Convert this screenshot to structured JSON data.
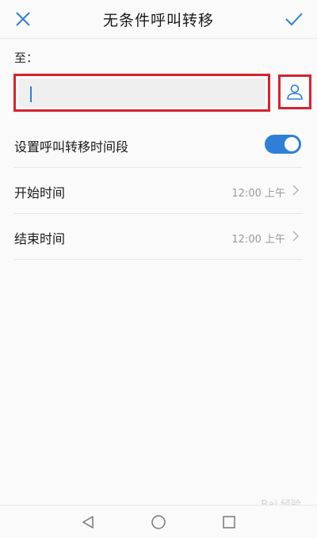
{
  "header": {
    "title": "无条件呼叫转移",
    "close_icon": "close-icon",
    "confirm_icon": "check-icon"
  },
  "forward_to": {
    "label": "至：",
    "value": "",
    "contact_icon": "person-icon"
  },
  "settings": {
    "schedule_label": "设置呼叫转移时间段",
    "schedule_enabled": true,
    "start_label": "开始时间",
    "start_value": "12:00 上午",
    "end_label": "结束时间",
    "end_value": "12:00 上午"
  },
  "navbar": {
    "back_icon": "back-triangle-icon",
    "home_icon": "home-circle-icon",
    "recents_icon": "recents-square-icon"
  },
  "watermark": "Bai 经验",
  "colors": {
    "accent": "#2f7fd6",
    "highlight_border": "#d6222f",
    "muted_text": "#9a9a9a"
  }
}
